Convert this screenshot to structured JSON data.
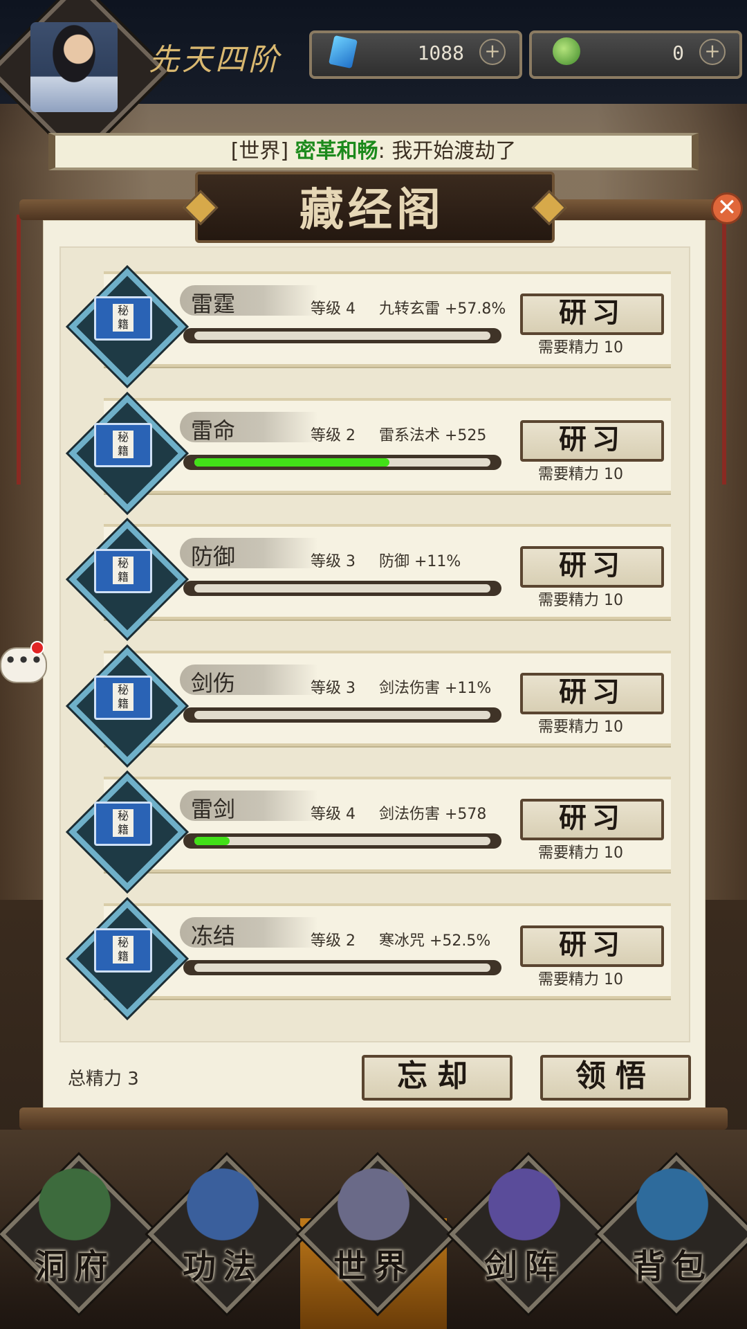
{
  "header": {
    "rank": "先天四阶",
    "currency": [
      {
        "icon": "spirit-crystal-icon",
        "value": "1088"
      },
      {
        "icon": "jade-gourd-icon",
        "value": "0"
      }
    ]
  },
  "world_chat": {
    "channel": "[世界]",
    "speaker": "密革和畅",
    "separator": ":",
    "message": "我开始渡劫了"
  },
  "panel": {
    "title": "藏经阁",
    "skills": [
      {
        "name": "雷霆",
        "level": "等级 4",
        "effect": "九转玄雷 +57.8%",
        "progress": 0.0,
        "button": "研习",
        "cost": "需要精力 10"
      },
      {
        "name": "雷命",
        "level": "等级 2",
        "effect": "雷系法术 +525",
        "progress": 0.66,
        "button": "研习",
        "cost": "需要精力 10"
      },
      {
        "name": "防御",
        "level": "等级 3",
        "effect": "防御 +11%",
        "progress": 0.0,
        "button": "研习",
        "cost": "需要精力 10"
      },
      {
        "name": "剑伤",
        "level": "等级 3",
        "effect": "剑法伤害 +11%",
        "progress": 0.0,
        "button": "研习",
        "cost": "需要精力 10"
      },
      {
        "name": "雷剑",
        "level": "等级 4",
        "effect": "剑法伤害 +578",
        "progress": 0.12,
        "button": "研习",
        "cost": "需要精力 10"
      },
      {
        "name": "冻结",
        "level": "等级 2",
        "effect": "寒冰咒 +52.5%",
        "progress": 0.0,
        "button": "研习",
        "cost": "需要精力 10"
      }
    ],
    "total_energy": "总精力 3",
    "forget_button": "忘却",
    "comprehend_button": "领悟"
  },
  "bottom_nav": [
    {
      "label": "洞府",
      "icon": "cave-dwelling-icon"
    },
    {
      "label": "功法",
      "icon": "technique-book-icon"
    },
    {
      "label": "世界",
      "icon": "world-map-icon"
    },
    {
      "label": "剑阵",
      "icon": "sword-formation-icon"
    },
    {
      "label": "背包",
      "icon": "backpack-icon"
    }
  ],
  "colors": {
    "progress_fill": "#42e018",
    "chat_speaker": "#1c8a1c",
    "title_gold": "#d9b870"
  }
}
